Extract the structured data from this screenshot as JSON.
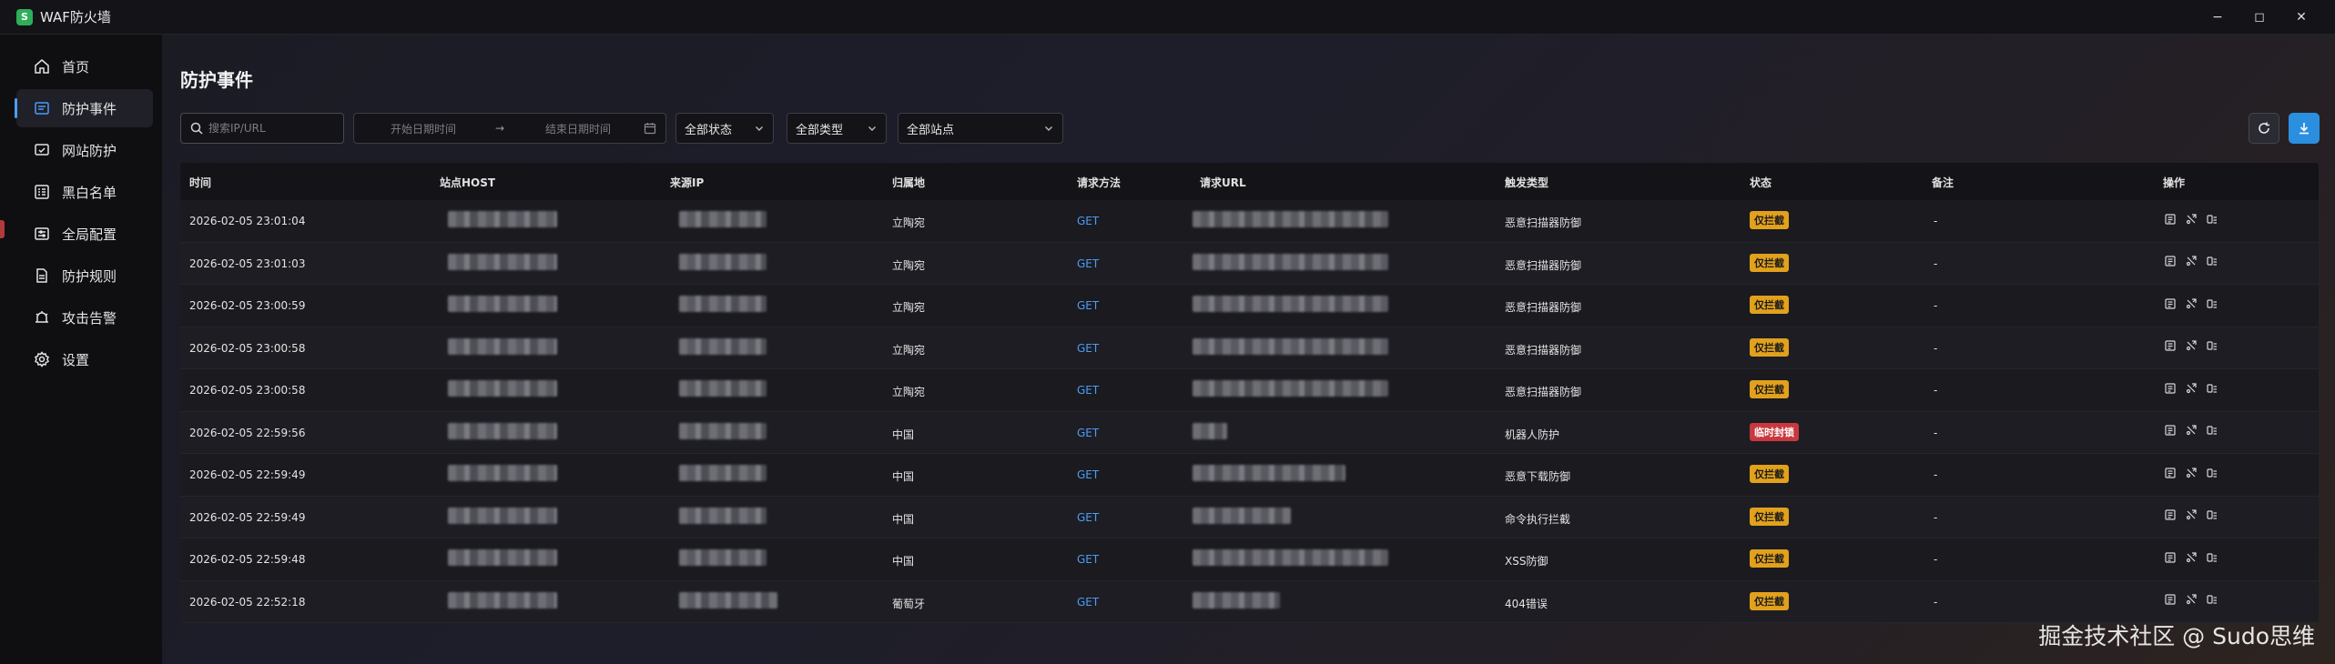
{
  "app": {
    "title": "WAF防火墙",
    "logo_text": "S"
  },
  "window_controls": {
    "minimize": "−",
    "maximize": "◻",
    "close": "✕"
  },
  "sidebar": {
    "items": [
      {
        "label": "首页",
        "icon": "home-icon",
        "active": false
      },
      {
        "label": "防护事件",
        "icon": "events-icon",
        "active": true
      },
      {
        "label": "网站防护",
        "icon": "site-shield-icon",
        "active": false
      },
      {
        "label": "黑白名单",
        "icon": "list-icon",
        "active": false
      },
      {
        "label": "全局配置",
        "icon": "global-config-icon",
        "active": false
      },
      {
        "label": "防护规则",
        "icon": "rules-icon",
        "active": false
      },
      {
        "label": "攻击告警",
        "icon": "alert-icon",
        "active": false
      },
      {
        "label": "设置",
        "icon": "settings-icon",
        "active": false
      }
    ]
  },
  "page": {
    "title": "防护事件"
  },
  "filters": {
    "search_placeholder": "搜索IP/URL",
    "date_start_placeholder": "开始日期时间",
    "date_arrow": "→",
    "date_end_placeholder": "结束日期时间",
    "status_select": "全部状态",
    "type_select": "全部类型",
    "site_select": "全部站点"
  },
  "colors": {
    "accent": "#4c9cf5",
    "warn": "#e2a11c",
    "danger": "#c9383f",
    "download": "#2b8fe0"
  },
  "table": {
    "headers": [
      "时间",
      "站点HOST",
      "来源IP",
      "归属地",
      "请求方法",
      "请求URL",
      "触发类型",
      "状态",
      "备注",
      "操作"
    ],
    "rows": [
      {
        "time": "2026-02-05 23:01:04",
        "location": "立陶宛",
        "method": "GET",
        "trigger": "恶意扫描器防御",
        "status": "仅拦截",
        "status_kind": "warn",
        "note": "-"
      },
      {
        "time": "2026-02-05 23:01:03",
        "location": "立陶宛",
        "method": "GET",
        "trigger": "恶意扫描器防御",
        "status": "仅拦截",
        "status_kind": "warn",
        "note": "-"
      },
      {
        "time": "2026-02-05 23:00:59",
        "location": "立陶宛",
        "method": "GET",
        "trigger": "恶意扫描器防御",
        "status": "仅拦截",
        "status_kind": "warn",
        "note": "-"
      },
      {
        "time": "2026-02-05 23:00:58",
        "location": "立陶宛",
        "method": "GET",
        "trigger": "恶意扫描器防御",
        "status": "仅拦截",
        "status_kind": "warn",
        "note": "-"
      },
      {
        "time": "2026-02-05 23:00:58",
        "location": "立陶宛",
        "method": "GET",
        "trigger": "恶意扫描器防御",
        "status": "仅拦截",
        "status_kind": "warn",
        "note": "-"
      },
      {
        "time": "2026-02-05 22:59:56",
        "location": "中国",
        "method": "GET",
        "trigger": "机器人防护",
        "status": "临时封锁",
        "status_kind": "danger",
        "note": "-"
      },
      {
        "time": "2026-02-05 22:59:49",
        "location": "中国",
        "method": "GET",
        "trigger": "恶意下载防御",
        "status": "仅拦截",
        "status_kind": "warn",
        "note": "-"
      },
      {
        "time": "2026-02-05 22:59:49",
        "location": "中国",
        "method": "GET",
        "trigger": "命令执行拦截",
        "status": "仅拦截",
        "status_kind": "warn",
        "note": "-"
      },
      {
        "time": "2026-02-05 22:59:48",
        "location": "中国",
        "method": "GET",
        "trigger": "XSS防御",
        "status": "仅拦截",
        "status_kind": "warn",
        "note": "-"
      },
      {
        "time": "2026-02-05 22:52:18",
        "location": "葡萄牙",
        "method": "GET",
        "trigger": "404错误",
        "status": "仅拦截",
        "status_kind": "warn",
        "note": "-"
      }
    ]
  },
  "watermark": "掘金技术社区 @ Sudo思维"
}
